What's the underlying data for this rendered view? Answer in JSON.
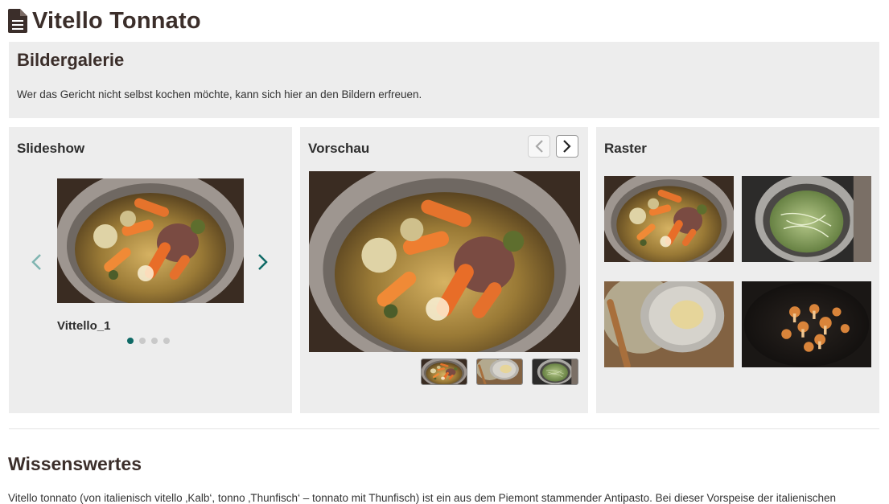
{
  "page": {
    "title": "Vitello Tonnato"
  },
  "gallery": {
    "heading": "Bildergalerie",
    "description": "Wer das Gericht nicht selbst kochen möchte, kann sich hier an den Bildern erfreuen."
  },
  "slideshow": {
    "heading": "Slideshow",
    "caption": "Vittello_1",
    "dot_count": 4,
    "active_dot": 1,
    "colors": {
      "arrow_prev": "#7fb5b1",
      "arrow_next": "#0f6a66",
      "dot_active": "#0f6a66",
      "dot_inactive": "#c9c9c9"
    }
  },
  "preview": {
    "heading": "Vorschau",
    "thumbnails": [
      "pot-with-vegetables",
      "tuna-sauce-bowl",
      "pot-with-greens"
    ]
  },
  "grid": {
    "heading": "Raster",
    "images": [
      "pot-with-vegetables",
      "pot-with-greens",
      "tuna-sauce-bowl",
      "mushrooms-in-pan"
    ]
  },
  "info": {
    "heading": "Wissenswertes",
    "text": "Vitello tonnato (von italienisch vitello ‚Kalb‘, tonno ‚Thunfisch‘ – tonnato mit Thunfisch) ist ein aus dem Piemont stammender Antipasto. Bei dieser Vorspeise der italienischen"
  },
  "icons": {
    "title_icon": "document-icon",
    "prev": "chevron-left-icon",
    "next": "chevron-right-icon"
  }
}
